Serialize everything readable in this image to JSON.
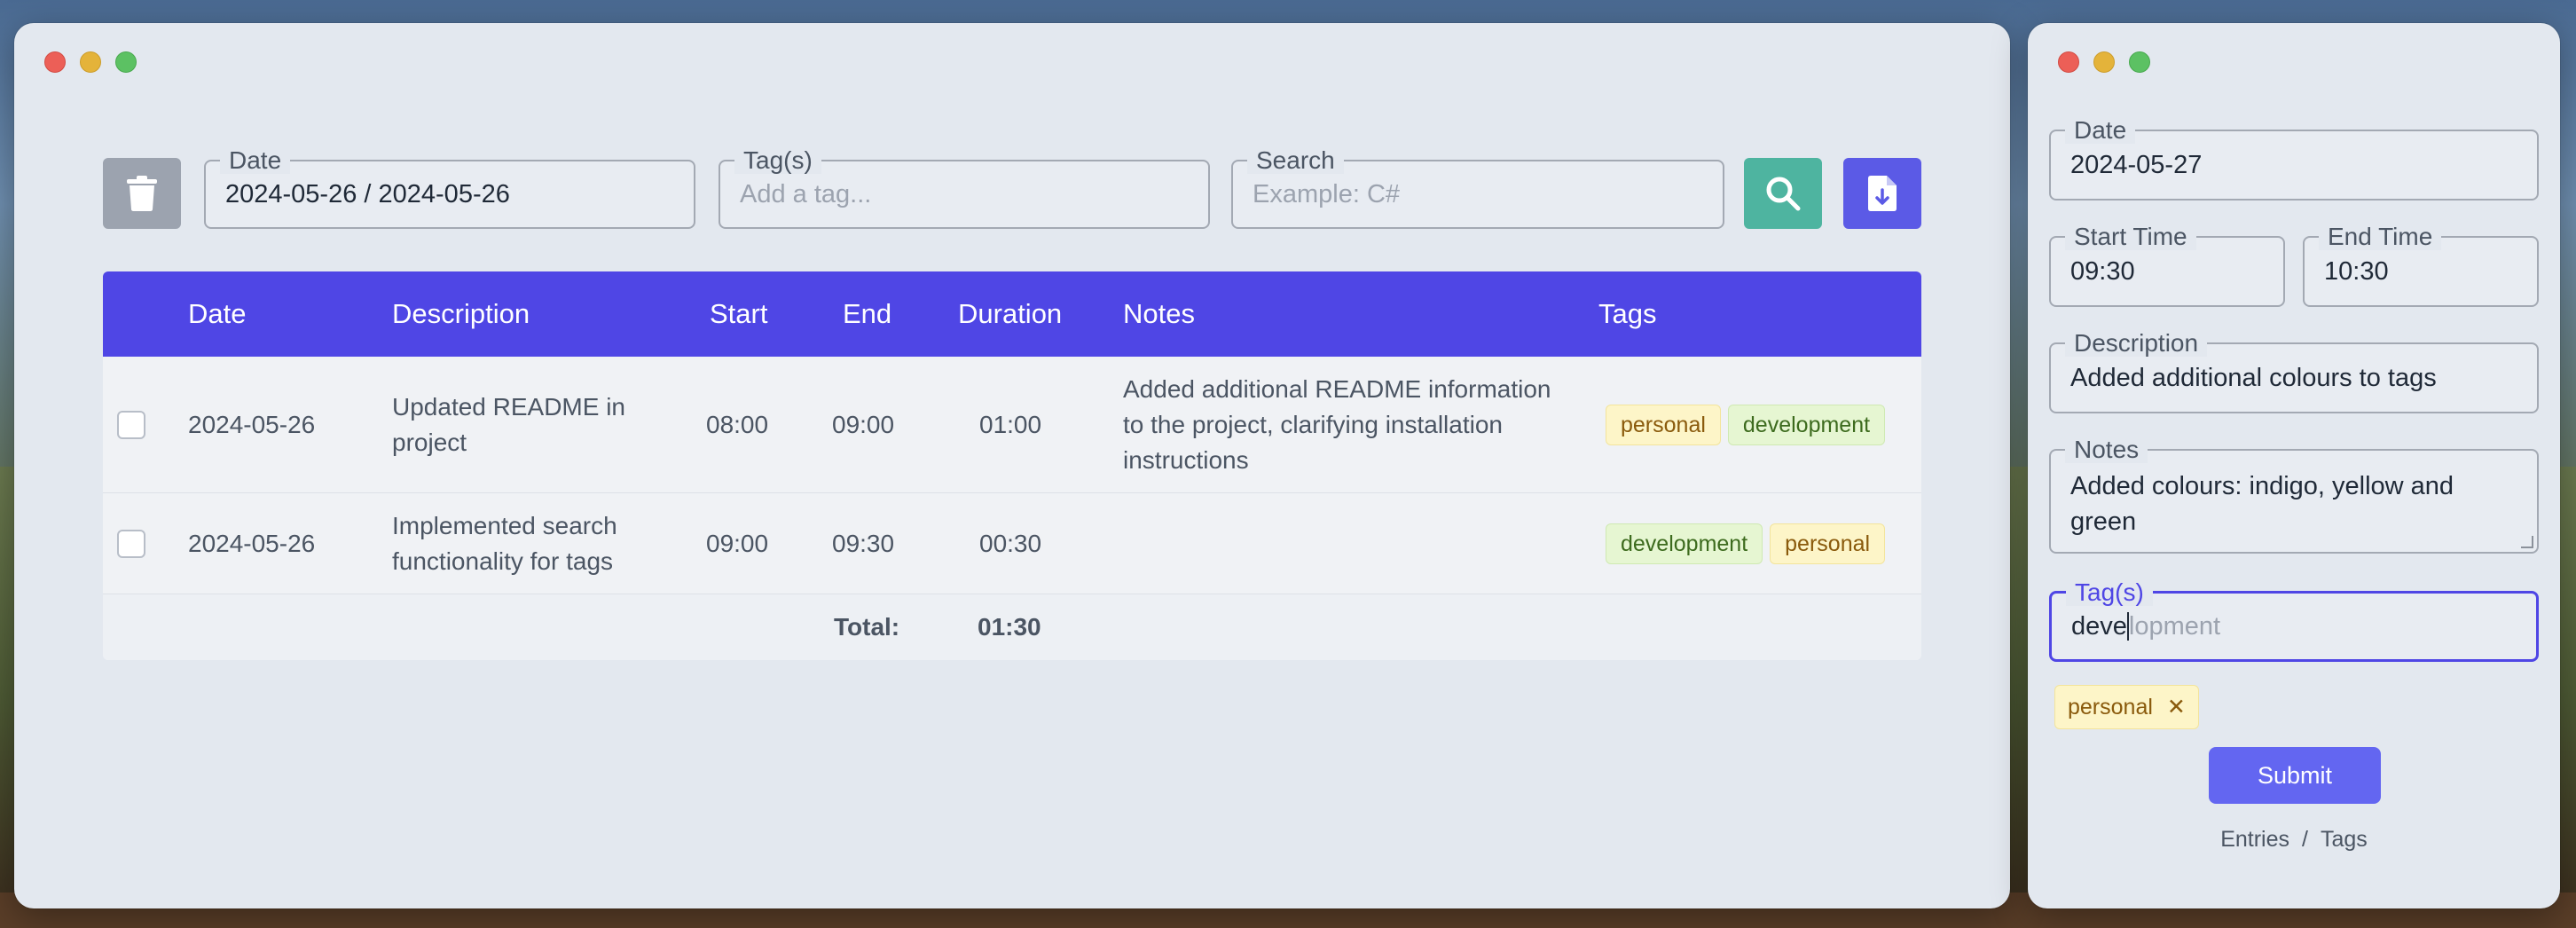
{
  "main": {
    "filters": {
      "date_legend": "Date",
      "date_value": "2024-05-26 / 2024-05-26",
      "tags_legend": "Tag(s)",
      "tags_placeholder": "Add a tag...",
      "search_legend": "Search",
      "search_placeholder": "Example: C#"
    },
    "table": {
      "headers": [
        "Date",
        "Description",
        "Start",
        "End",
        "Duration",
        "Notes",
        "Tags"
      ],
      "rows": [
        {
          "date": "2024-05-26",
          "description": "Updated README in project",
          "start": "08:00",
          "end": "09:00",
          "duration": "01:00",
          "notes": "Added additional README information to the project, clarifying installation instructions",
          "tags": [
            "personal",
            "development"
          ]
        },
        {
          "date": "2024-05-26",
          "description": "Implemented search functionality for tags",
          "start": "09:00",
          "end": "09:30",
          "duration": "00:30",
          "notes": "",
          "tags": [
            "development",
            "personal"
          ]
        }
      ],
      "total_label": "Total:",
      "total_value": "01:30"
    }
  },
  "form": {
    "date_legend": "Date",
    "date_value": "2024-05-27",
    "start_legend": "Start Time",
    "start_value": "09:30",
    "end_legend": "End Time",
    "end_value": "10:30",
    "description_legend": "Description",
    "description_value": "Added additional colours to tags",
    "notes_legend": "Notes",
    "notes_value": "Added colours: indigo, yellow and green",
    "tags_legend": "Tag(s)",
    "tags_typed": "deve",
    "tags_suggestion": "lopment",
    "selected_tag": "personal",
    "remove_icon": "✕",
    "submit_label": "Submit",
    "link_entries": "Entries",
    "link_separator": "/",
    "link_tags": "Tags"
  },
  "colors": {
    "accent": "#4f46e5",
    "search_button": "#4eb4a0",
    "tag_personal_bg": "#fdf5c8",
    "tag_development_bg": "#e6f6d2"
  }
}
